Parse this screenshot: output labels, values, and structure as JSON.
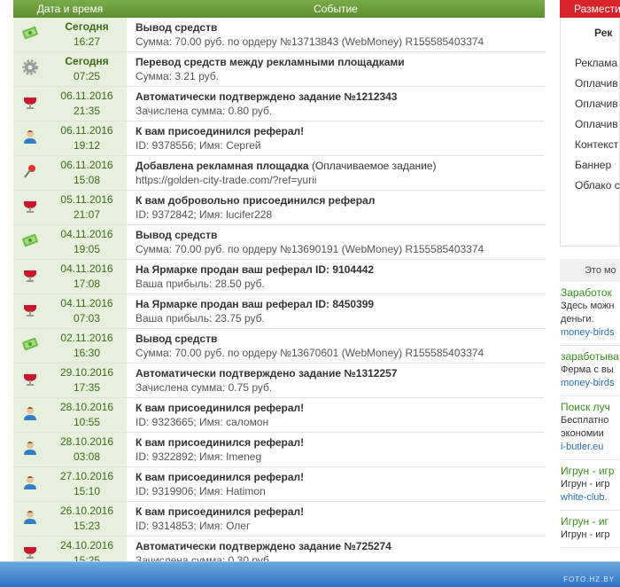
{
  "header": {
    "col_date": "Дата и время",
    "col_event": "Событие"
  },
  "rows": [
    {
      "icon": "money-icon",
      "date": "Сегодня",
      "time": "16:27",
      "today": true,
      "title": "Вывод средств",
      "title_note": "",
      "sub": "Сумма: 70.00 руб. по ордеру №13713843 (WebMoney) R155585403374"
    },
    {
      "icon": "gear-icon",
      "date": "Сегодня",
      "time": "07:25",
      "today": true,
      "title": "Перевод средств между рекламными площадками",
      "title_note": "",
      "sub": "Сумма: 3.21 руб."
    },
    {
      "icon": "task-icon",
      "date": "06.11.2016",
      "time": "21:35",
      "today": false,
      "title": "Автоматически подтверждено задание №1212343",
      "title_note": "",
      "sub": "Зачислена сумма: 0.80 руб."
    },
    {
      "icon": "user-icon",
      "date": "06.11.2016",
      "time": "19:12",
      "today": false,
      "title": "К вам присоединился реферал!",
      "title_note": "",
      "sub": "ID: 9378556; Имя: Сергей"
    },
    {
      "icon": "pin-icon",
      "date": "06.11.2016",
      "time": "15:08",
      "today": false,
      "title": "Добавлена рекламная площадка",
      "title_note": " (Оплачиваемое задание)",
      "sub": "https://golden-city-trade.com/?ref=yurii"
    },
    {
      "icon": "task-icon",
      "date": "05.11.2016",
      "time": "21:07",
      "today": false,
      "title": "К вам добровольно присоединился реферал",
      "title_note": "",
      "sub": "ID: 9372842; Имя: lucifer228"
    },
    {
      "icon": "money-icon",
      "date": "04.11.2016",
      "time": "19:05",
      "today": false,
      "title": "Вывод средств",
      "title_note": "",
      "sub": "Сумма: 70.00 руб. по ордеру №13690191 (WebMoney) R155585403374"
    },
    {
      "icon": "task-icon",
      "date": "04.11.2016",
      "time": "17:08",
      "today": false,
      "title": "На Ярмарке продан ваш реферал ID: 9104442",
      "title_note": "",
      "sub": "Ваша прибыль: 28.50 руб."
    },
    {
      "icon": "task-icon",
      "date": "04.11.2016",
      "time": "07:03",
      "today": false,
      "title": "На Ярмарке продан ваш реферал ID: 8450399",
      "title_note": "",
      "sub": "Ваша прибыль: 23.75 руб."
    },
    {
      "icon": "money-icon",
      "date": "02.11.2016",
      "time": "16:30",
      "today": false,
      "title": "Вывод средств",
      "title_note": "",
      "sub": "Сумма: 70.00 руб. по ордеру №13670601 (WebMoney) R155585403374"
    },
    {
      "icon": "task-icon",
      "date": "29.10.2016",
      "time": "17:35",
      "today": false,
      "title": "Автоматически подтверждено задание №1312257",
      "title_note": "",
      "sub": "Зачислена сумма: 0.75 руб."
    },
    {
      "icon": "user-icon",
      "date": "28.10.2016",
      "time": "10:55",
      "today": false,
      "title": "К вам присоединился реферал!",
      "title_note": "",
      "sub": "ID: 9323665; Имя: саломон"
    },
    {
      "icon": "user-icon",
      "date": "28.10.2016",
      "time": "03:08",
      "today": false,
      "title": "К вам присоединился реферал!",
      "title_note": "",
      "sub": "ID: 9322892; Имя: Imeneg"
    },
    {
      "icon": "user-icon",
      "date": "27.10.2016",
      "time": "15:10",
      "today": false,
      "title": "К вам присоединился реферал!",
      "title_note": "",
      "sub": "ID: 9319906; Имя: Hatimon"
    },
    {
      "icon": "user-icon",
      "date": "26.10.2016",
      "time": "15:23",
      "today": false,
      "title": "К вам присоединился реферал!",
      "title_note": "",
      "sub": "ID: 9314853; Имя: Олег"
    },
    {
      "icon": "task-icon",
      "date": "24.10.2016",
      "time": "15:25",
      "today": false,
      "title": "Автоматически подтверждено задание №725274",
      "title_note": "",
      "sub": "Зачислена сумма: 0.30 руб."
    }
  ],
  "sidebar": {
    "button": "Размести",
    "box_title": "Рек",
    "menu": [
      "Реклама",
      "Оплачив",
      "Оплачив",
      "Оплачив",
      "Контекст",
      "Баннер",
      "Облако с"
    ],
    "ads_header": "Это мо",
    "ads": [
      {
        "title": "Заработок",
        "desc": [
          "Здесь можн",
          "деньги."
        ],
        "url": "money-birds"
      },
      {
        "title": "заработыва",
        "desc": [
          "Ферма с вы"
        ],
        "url": "money-birds"
      },
      {
        "title": "Поиск луч",
        "desc": [
          "Бесплатно",
          "экономии"
        ],
        "url": "i-butler.eu"
      },
      {
        "title": "Игрун - игр",
        "desc": [
          "Игрун - игр"
        ],
        "url": "white-club."
      },
      {
        "title": "Игрун - иг",
        "desc": [
          "Игрун - игр"
        ],
        "url": ""
      }
    ]
  },
  "watermark": "FOTO.HZ.BY"
}
